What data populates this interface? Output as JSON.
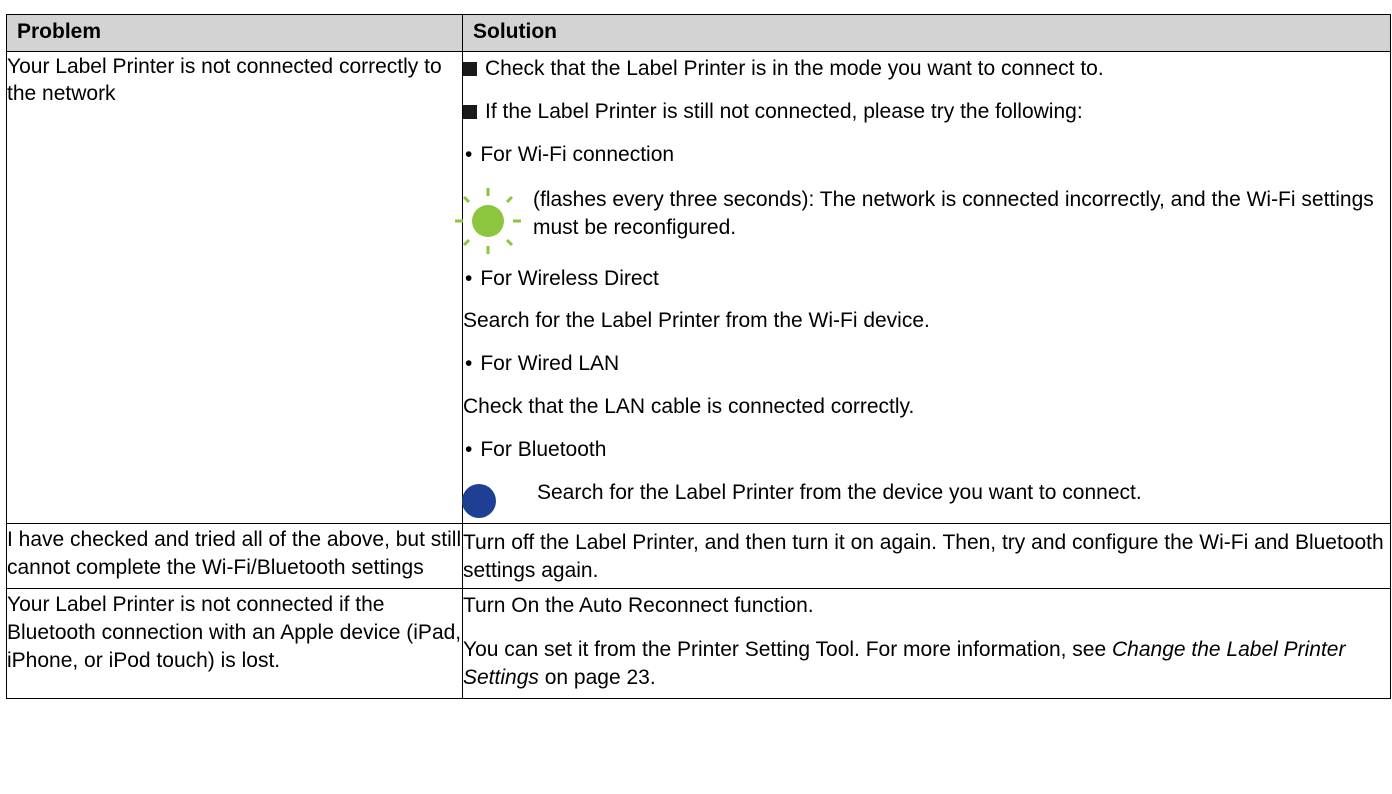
{
  "table": {
    "headers": {
      "problem": "Problem",
      "solution": "Solution"
    },
    "row1": {
      "problem": "Your Label Printer is not connected correctly to the network",
      "s1": "Check that the Label Printer is in the mode you want to connect to.",
      "s2": "If the Label Printer is still not connected, please try the following:",
      "wifi_heading": "For Wi-Fi connection",
      "wifi_led_text": "(flashes every three seconds): The network is connected incorrectly, and the Wi-Fi settings must be reconfigured.",
      "wd_heading": "For Wireless Direct",
      "wd_text": "Search for the Label Printer from the Wi-Fi device.",
      "lan_heading": "For Wired LAN",
      "lan_text": "Check that the LAN cable is connected correctly.",
      "bt_heading": "For Bluetooth",
      "bt_text": "Search for the Label Printer from the device you want to connect."
    },
    "row2": {
      "problem": "I have checked and tried all of the above, but still cannot complete the Wi-Fi/Bluetooth settings",
      "solution": "Turn off the Label Printer, and then turn it on again. Then, try and configure the Wi-Fi and Bluetooth settings again."
    },
    "row3": {
      "problem": "Your Label Printer is not connected if the Bluetooth connection with an Apple device (iPad, iPhone, or iPod touch) is lost.",
      "s1": "Turn On the Auto Reconnect function.",
      "s2_pre": "You can set it from the Printer Setting Tool. For more information, see ",
      "s2_ref": "Change the Label Printer Settings",
      "s2_post": " on page 23."
    }
  },
  "icons": {
    "wifi_led": "green-led-flashing-icon",
    "bt_led": "blue-led-icon"
  },
  "colors": {
    "header_bg": "#d3d3d3",
    "led_green": "#8cc63f",
    "led_blue": "#1f3f94"
  }
}
